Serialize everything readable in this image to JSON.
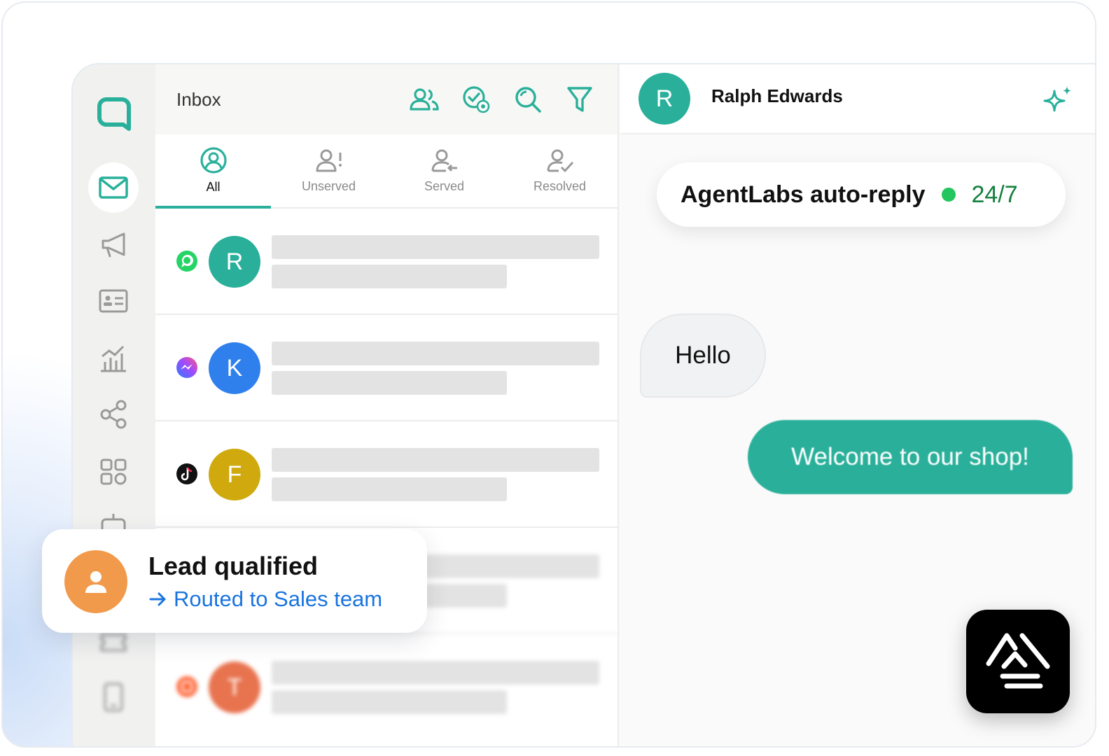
{
  "inbox": {
    "title": "Inbox",
    "header_icons": [
      "people-icon",
      "whatsapp-check-icon",
      "search-icon",
      "filter-icon"
    ],
    "tabs": [
      {
        "label": "All",
        "icon": "user-circle-icon",
        "active": true
      },
      {
        "label": "Unserved",
        "icon": "user-alert-icon",
        "active": false
      },
      {
        "label": "Served",
        "icon": "user-arrow-icon",
        "active": false
      },
      {
        "label": "Resolved",
        "icon": "user-check-icon",
        "active": false
      }
    ],
    "conversations": [
      {
        "initial": "R",
        "channel": "whatsapp-icon",
        "color": "#2ab09a"
      },
      {
        "initial": "K",
        "channel": "messenger-icon",
        "color": "#2f80ed"
      },
      {
        "initial": "F",
        "channel": "tiktok-icon",
        "color": "#cfa90d"
      },
      {
        "initial": "",
        "channel": "",
        "color": ""
      },
      {
        "initial": "T",
        "channel": "instagram-icon",
        "color": "#e8734f"
      }
    ]
  },
  "sidebar": {
    "items": [
      "inbox-icon",
      "megaphone-icon",
      "contact-card-icon",
      "analytics-icon",
      "share-icon",
      "apps-icon",
      "bot-icon",
      "ticket-icon",
      "mobile-icon"
    ]
  },
  "chat": {
    "contact_initial": "R",
    "contact_name": "Ralph Edwards",
    "auto_reply_label": "AgentLabs auto-reply",
    "auto_reply_hours": "24/7",
    "messages": [
      {
        "direction": "incoming",
        "text": "Hello"
      },
      {
        "direction": "outgoing",
        "text": "Welcome to our shop!"
      }
    ]
  },
  "lead_card": {
    "title": "Lead qualified",
    "subtitle": "Routed to Sales team"
  },
  "colors": {
    "accent": "#2ab09a",
    "status_online": "#22c55e",
    "link": "#1a74e0"
  }
}
